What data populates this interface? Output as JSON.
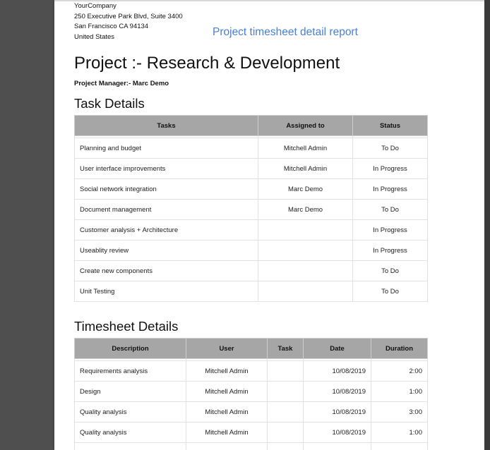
{
  "company": {
    "name": "YourCompany",
    "street": "250 Executive Park Blvd, Suite 3400",
    "city": "San Francisco CA 94134",
    "country": "United States"
  },
  "report_title": "Project timesheet detail report",
  "project": {
    "title": "Project :- Research & Development",
    "manager": "Project Manager:- Marc Demo"
  },
  "task_details": {
    "title": "Task Details",
    "headers": [
      "Tasks",
      "Assigned to",
      "Status"
    ],
    "rows": [
      [
        "Planning and budget",
        "Mitchell Admin",
        "To Do"
      ],
      [
        "User interface improvements",
        "Mitchell Admin",
        "In Progress"
      ],
      [
        "Social network integration",
        "Marc Demo",
        "In Progress"
      ],
      [
        "Document management",
        "Marc Demo",
        "To Do"
      ],
      [
        "Customer analysis + Architecture",
        "",
        "In Progress"
      ],
      [
        "Useablity review",
        "",
        "In Progress"
      ],
      [
        "Create new components",
        "",
        "To Do"
      ],
      [
        "Unit Testing",
        "",
        "To Do"
      ]
    ]
  },
  "timesheet_details": {
    "title": "Timesheet Details",
    "headers": [
      "Description",
      "User",
      "Task",
      "Date",
      "Duration"
    ],
    "rows": [
      [
        "Requirements analysis",
        "Mitchell Admin",
        "",
        "10/08/2019",
        "2:00"
      ],
      [
        "Design",
        "Mitchell Admin",
        "",
        "10/08/2019",
        "1:00"
      ],
      [
        "Quality analysis",
        "Mitchell Admin",
        "",
        "10/08/2019",
        "3:00"
      ],
      [
        "Quality analysis",
        "Mitchell Admin",
        "",
        "10/08/2019",
        "1:00"
      ],
      [
        "",
        "",
        "",
        "",
        ""
      ]
    ]
  }
}
